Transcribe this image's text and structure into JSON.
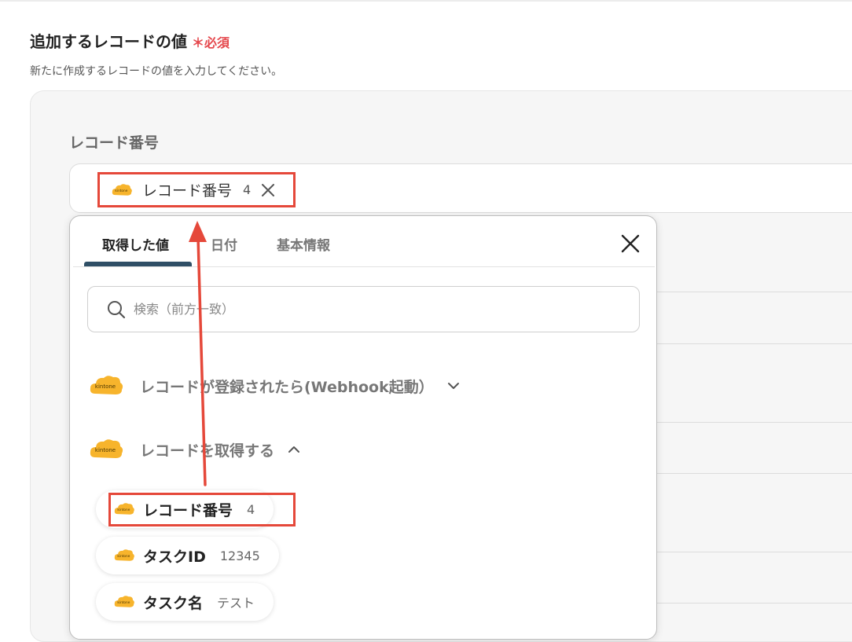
{
  "section": {
    "title": "追加するレコードの値",
    "required_mark": "＊",
    "required_label": "必須",
    "description": "新たに作成するレコードの値を入力してください。"
  },
  "field": {
    "label": "レコード番号",
    "chip": {
      "label": "レコード番号",
      "value": "4"
    }
  },
  "popup": {
    "tabs": [
      {
        "label": "取得した値",
        "active": true
      },
      {
        "label": "日付",
        "active": false
      },
      {
        "label": "基本情報",
        "active": false
      }
    ],
    "search_placeholder": "検索（前方一致）",
    "groups": [
      {
        "label": "レコードが登録されたら(Webhook起動）",
        "expanded": false,
        "icon": "kintone-logo"
      },
      {
        "label": "レコードを取得する",
        "expanded": true,
        "icon": "kintone-logo"
      }
    ],
    "items": [
      {
        "label": "レコード番号",
        "value": "4"
      },
      {
        "label": "タスクID",
        "value": "12345"
      },
      {
        "label": "タスク名",
        "value": "テスト"
      }
    ]
  },
  "icons": {
    "app": "kintone-logo",
    "search": "search-icon",
    "close": "close-icon"
  },
  "colors": {
    "highlight": "#e5483a",
    "required": "#e5484d",
    "tab_active": "#2f4f66",
    "kintone": "#f7b42c"
  }
}
